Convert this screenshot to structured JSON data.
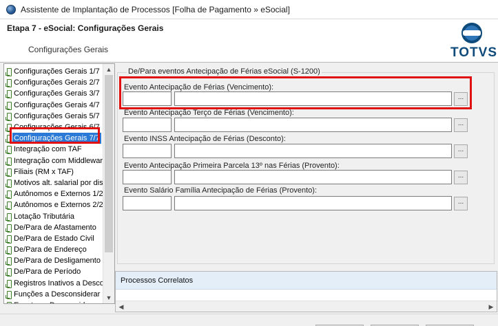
{
  "window": {
    "title": "Assistente de Implantação de Processos [Folha de Pagamento » eSocial]"
  },
  "header": {
    "step_title": "Etapa 7 - eSocial: Configurações Gerais",
    "step_subtitle": "Configurações Gerais",
    "logo_text": "TOTVS"
  },
  "tree": {
    "items": [
      "Configurações Gerais 1/7",
      "Configurações Gerais 2/7",
      "Configurações Gerais 3/7",
      "Configurações Gerais 4/7",
      "Configurações Gerais 5/7",
      "Configurações Gerais 6/7",
      "Configurações Gerais 7/7",
      "Integração com TAF",
      "Integração com Middleware",
      "Filiais (RM x TAF)",
      "Motivos alt. salarial por diss",
      "Autônomos e Externos 1/2",
      "Autônomos e Externos 2/2",
      "Lotação Tributária",
      "De/Para de Afastamento",
      "De/Para de Estado Civil",
      "De/Para de Endereço",
      "De/Para de Desligamento",
      "De/Para de Período",
      "Registros Inativos a Desco",
      "Funções a Desconsiderar",
      "Eventos a Desconsiderar"
    ],
    "selected": "Configurações Gerais 7/7"
  },
  "group": {
    "legend": "De/Para eventos Antecipação de Férias eSocial (S-1200)",
    "fields": [
      {
        "label": "Evento Antecipação de Férias (Vencimento):",
        "code": "",
        "description": ""
      },
      {
        "label": "Evento Antecipação Terço de Férias (Vencimento):",
        "code": "",
        "description": ""
      },
      {
        "label": "Evento INSS Antecipação de Férias (Desconto):",
        "code": "",
        "description": ""
      },
      {
        "label": "Evento Antecipação Primeira Parcela 13º nas Férias (Provento):",
        "code": "",
        "description": ""
      },
      {
        "label": "Evento Salário Família Antecipação de Férias (Provento):",
        "code": "",
        "description": ""
      }
    ],
    "lookup_label": "..."
  },
  "bottom": {
    "title": "Processos Correlatos"
  },
  "colors": {
    "highlight": "#e01010",
    "selection": "#2a79d6",
    "brand": "#0e4a7a"
  },
  "icons": {
    "app": "totvs-app-icon",
    "leaf": "document-leaf-icon",
    "scroll_up": "chevron-up-icon",
    "scroll_down": "chevron-down-icon",
    "scroll_left": "chevron-left-icon",
    "scroll_right": "chevron-right-icon"
  }
}
